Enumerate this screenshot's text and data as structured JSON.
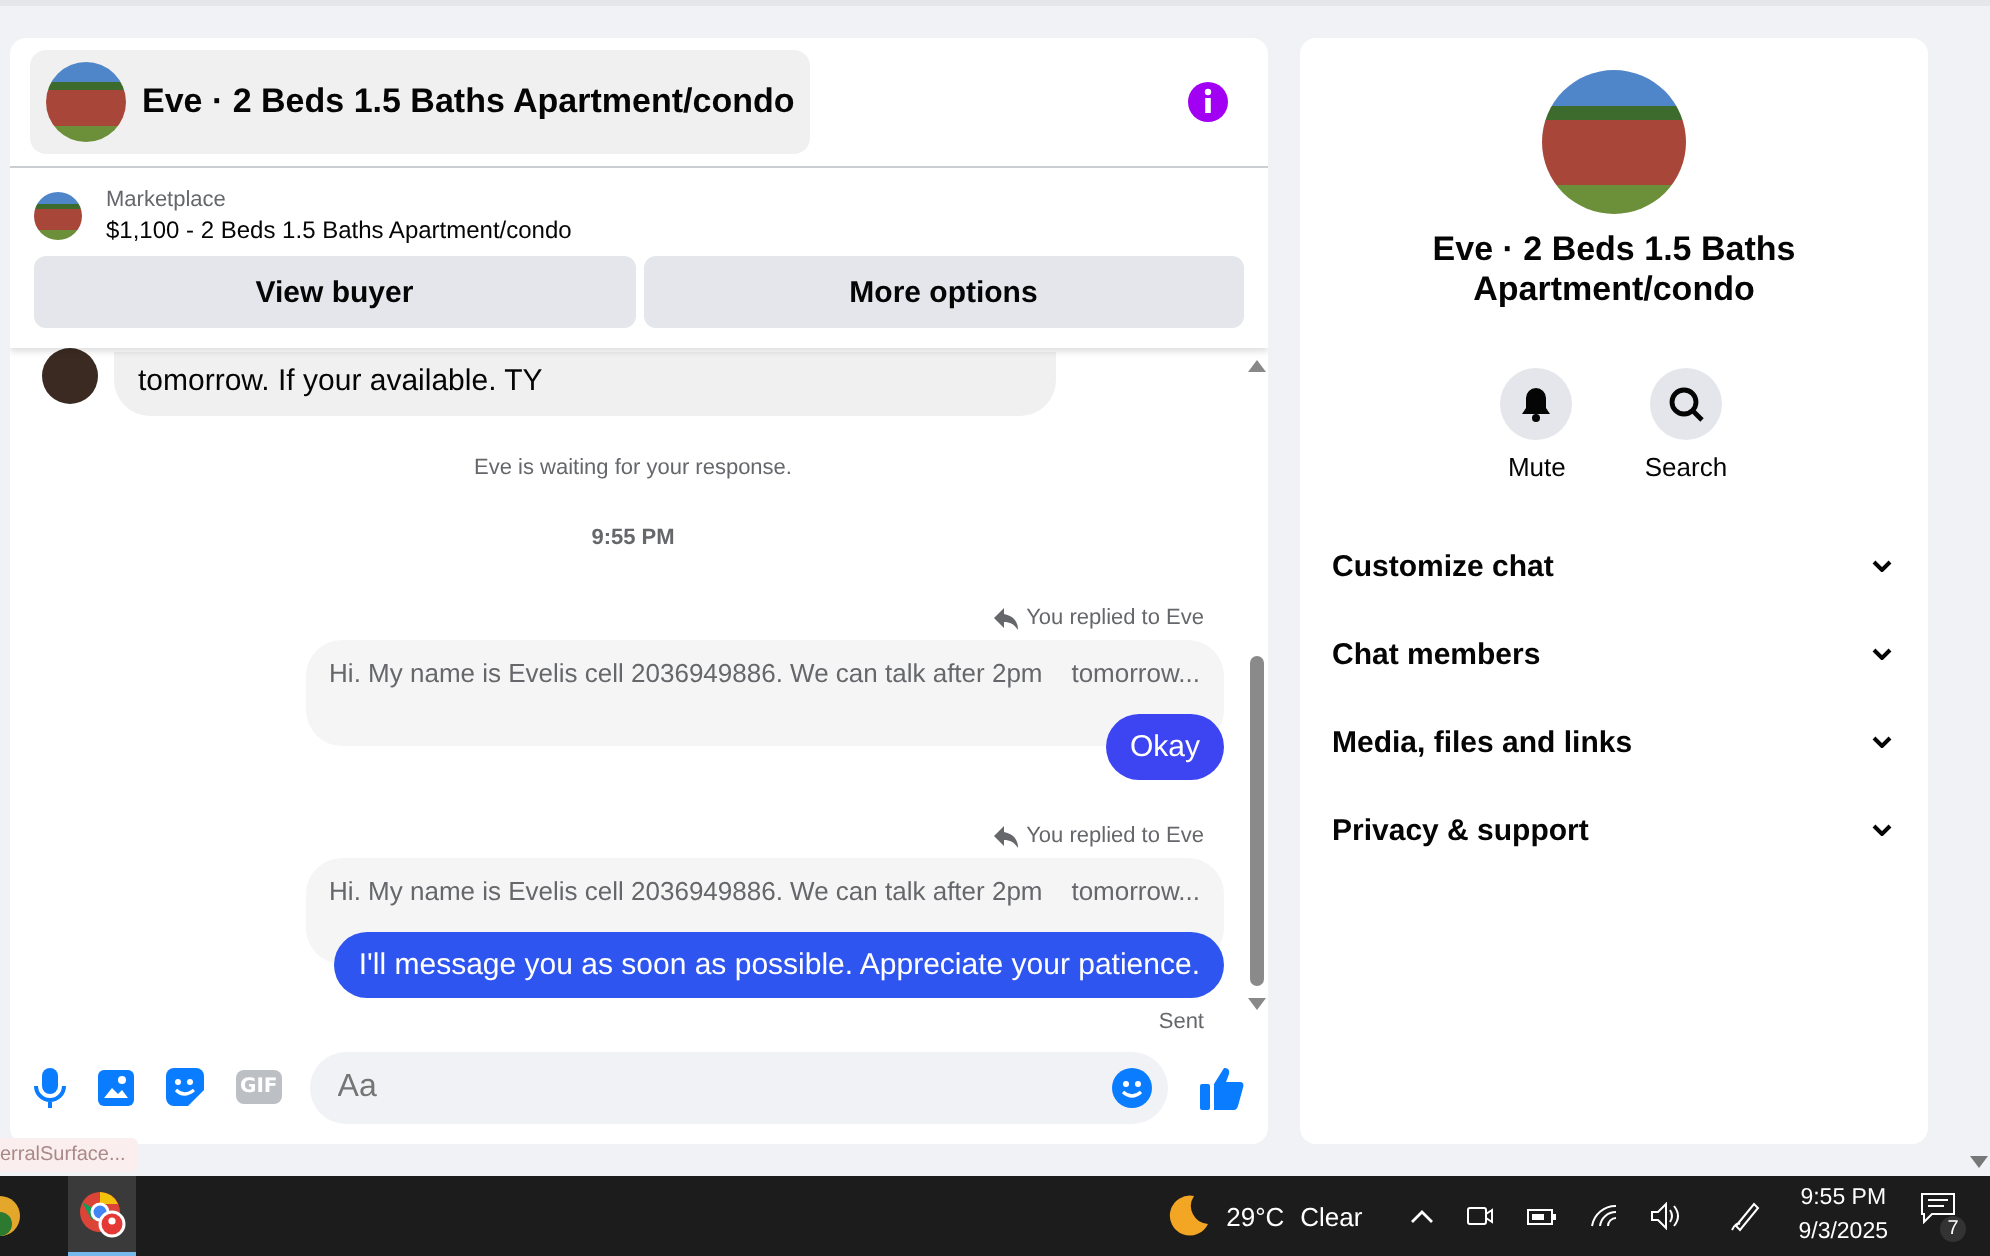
{
  "chat": {
    "header": {
      "title": "Eve · 2 Beds 1.5 Baths Apartment/condo"
    },
    "listing": {
      "source": "Marketplace",
      "summary": "$1,100 - 2 Beds 1.5 Baths Apartment/condo",
      "buttons": [
        "View buyer",
        "More options"
      ]
    },
    "messages": [
      {
        "kind": "incoming",
        "text": "tomorrow. If  your available. TY"
      },
      {
        "kind": "notice",
        "text": "Eve is waiting for your response."
      },
      {
        "kind": "time",
        "text": "9:55 PM"
      },
      {
        "kind": "reply",
        "replied_label": "You replied to Eve",
        "quoted": "Hi. My name is Evelis cell 2036949886. We can talk after 2pm    tomorrow...",
        "text": "Okay"
      },
      {
        "kind": "reply",
        "replied_label": "You replied to Eve",
        "quoted": "Hi. My name is Evelis cell 2036949886. We can talk after 2pm    tomorrow...",
        "text": "I'll message you as soon as possible. Appreciate your patience.",
        "status": "Sent"
      }
    ],
    "composer": {
      "tools": [
        {
          "kind": "mic"
        },
        {
          "kind": "image"
        },
        {
          "kind": "sticker"
        },
        {
          "kind": "gif",
          "label": "GIF"
        }
      ],
      "placeholder": "Aa"
    }
  },
  "details": {
    "title": "Eve · 2 Beds 1.5 Baths Apartment/condo",
    "actions": [
      {
        "kind": "bell",
        "label": "Mute"
      },
      {
        "kind": "search",
        "label": "Search"
      }
    ],
    "sections": [
      {
        "label": "Customize chat",
        "expanded": false
      },
      {
        "label": "Chat members",
        "expanded": false
      },
      {
        "label": "Media, files and links",
        "expanded": false
      },
      {
        "label": "Privacy & support",
        "expanded": false
      }
    ]
  },
  "tooltip": "erralSurface...",
  "taskbar": {
    "weather": {
      "temperature": "29°C",
      "condition": "Clear"
    },
    "time": "9:55 PM",
    "date": "9/3/2025",
    "notification_count": "7"
  }
}
